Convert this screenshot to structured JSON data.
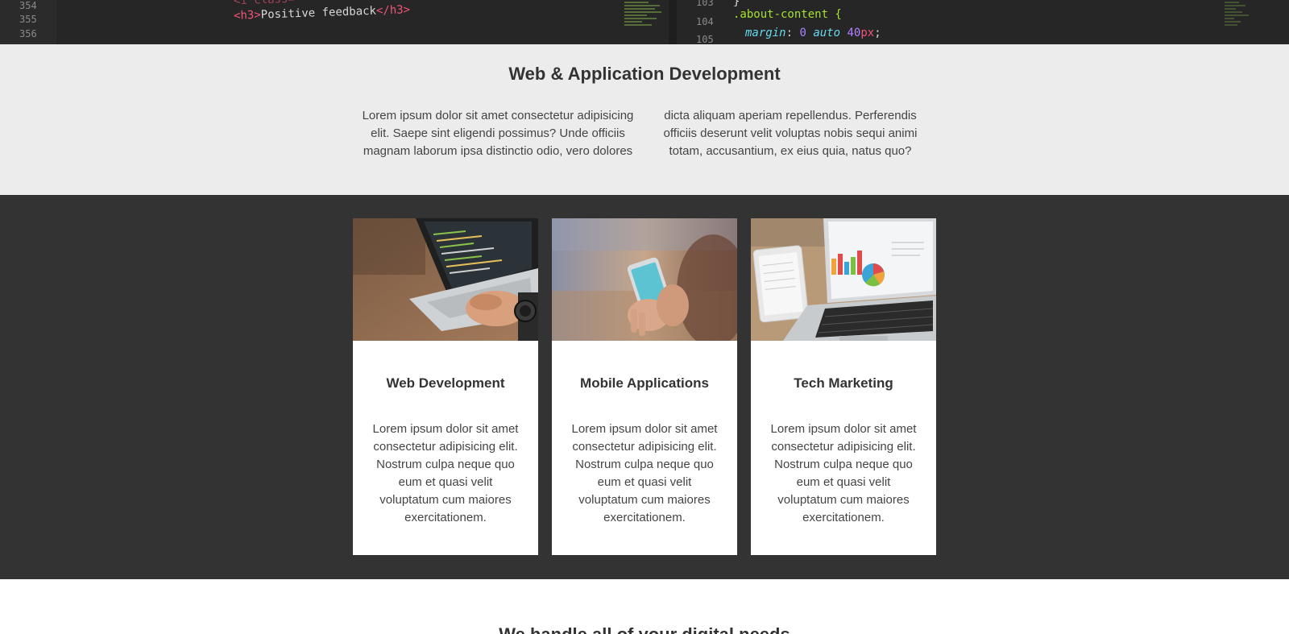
{
  "code_banner": {
    "left_lines": [
      "354",
      "355",
      "356"
    ],
    "left_code_partial": "<i class=",
    "left_code_tag_open": "<h3>",
    "left_code_text": "Positive feedback",
    "left_code_tag_close": "</h3>",
    "right_lines": [
      "103",
      "104",
      "105"
    ],
    "right_brace": "}",
    "right_selector": ".about-content {",
    "right_prop": "margin",
    "right_value_zero": "0",
    "right_value_auto": "auto",
    "right_value_num": "40",
    "right_value_unit": "px"
  },
  "intro": {
    "title": "Web & Application Development",
    "col_left": "Lorem ipsum dolor sit amet consectetur adipisicing elit. Saepe sint eligendi possimus? Unde officiis magnam laborum ipsa distinctio odio, vero dolores",
    "col_right": "dicta aliquam aperiam repellendus. Perferendis officiis deserunt velit voluptas nobis sequi animi totam, accusantium, ex eius quia, natus quo?"
  },
  "cards": [
    {
      "title": "Web Development",
      "text": "Lorem ipsum dolor sit amet consectetur adipisicing elit. Nostrum culpa neque quo eum et quasi velit voluptatum cum maiores exercitationem.",
      "image": "laptop-coding-photo"
    },
    {
      "title": "Mobile Applications",
      "text": "Lorem ipsum dolor sit amet consectetur adipisicing elit. Nostrum culpa neque quo eum et quasi velit voluptatum cum maiores exercitationem.",
      "image": "smartphone-in-hands-photo"
    },
    {
      "title": "Tech Marketing",
      "text": "Lorem ipsum dolor sit amet consectetur adipisicing elit. Nostrum culpa neque quo eum et quasi velit voluptatum cum maiores exercitationem.",
      "image": "laptop-charts-tablet-photo"
    }
  ],
  "next_section": {
    "title": "We handle all of your digital needs"
  },
  "colors": {
    "dark_section": "#333333",
    "light_section": "#ececec",
    "card_bg": "#ffffff",
    "text": "#333333"
  }
}
